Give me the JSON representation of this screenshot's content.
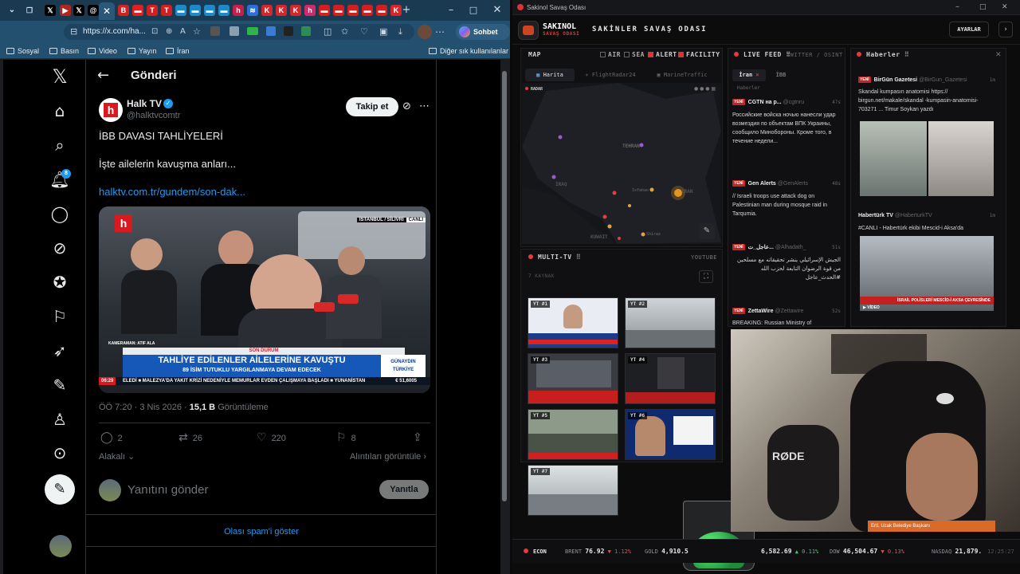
{
  "browser": {
    "url": "https://x.com/ha...",
    "copilot_label": "Sohbet et",
    "bookmarks": [
      "Sosyal",
      "Basın",
      "Video",
      "Yayın",
      "İran"
    ],
    "other_bookmarks": "Diğer sık kullanılanlar"
  },
  "x": {
    "header_title": "Gönderi",
    "author_name": "Halk TV",
    "author_handle": "@halktvcomtr",
    "follow_label": "Takip et",
    "post_line1": "İBB DAVASI TAHLİYELERİ",
    "post_line2": "İşte ailelerin kavuşma anları...",
    "post_link": "halktv.com.tr/gundem/son-dak...",
    "notif_count": "8",
    "video": {
      "location_tag": "İSTANBUL / SİLİVRİ",
      "live_tag": "CANLI",
      "cameraman": "KAMERAMAN: ATIF ALA",
      "son_durum": "SON DURUM",
      "headline": "TAHLİYE EDİLENLER AİLELERİNE KAVUŞTU",
      "subheadline": "89 İSİM TUTUKLU YARGILANMAYA DEVAM EDECEK",
      "ticker": "ELEDİ  ■ MALEZYA'DA YAKIT KRİZİ NEDENİYLE MEMURLAR EVDEN ÇALIŞMAYA BAŞLADI  ■ YUNANİSTAN",
      "time": "06:29",
      "program": "GÜNAYDIN TÜRKİYE",
      "euro": "€ 51,6005"
    },
    "meta_time": "ÖÖ 7:20 · 3 Nis 2026 · ",
    "views_count": "15,1 B",
    "views_label": " Görüntüleme",
    "replies": "2",
    "reposts": "26",
    "likes": "220",
    "bookmarks": "8",
    "relevant": "Alakalı",
    "quotes": "Alıntıları görüntüle",
    "reply_placeholder": "Yanıtını gönder",
    "reply_button": "Yanıtla",
    "spam_link": "Olası spam'i göster"
  },
  "dash": {
    "window_title": "Sakinol Savaş Odası",
    "logo_top": "SAKINOL",
    "logo_bottom": "SAVAŞ ODASI",
    "header_title": "SAKİNLER SAVAŞ ODASI",
    "settings": "AYARLAR",
    "map": {
      "label": "MAP",
      "toggles": [
        "AIR",
        "SEA",
        "ALERT",
        "FACILITY"
      ],
      "tabs": [
        "Harita",
        "FlightRadar24",
        "MarineTraffic"
      ],
      "radar": "RADAR",
      "places": [
        "TEHRAN",
        "IRAQ",
        "Isfahan",
        "IRAN",
        "KUWAIT",
        "Shiraz"
      ]
    },
    "feed": {
      "label": "LIVE FEED",
      "sub": "TWITTER / OSINT",
      "tabs": [
        "İran",
        "İBB"
      ],
      "haberler_tab": "Haberler",
      "items": [
        {
          "src": "CGTN на р...",
          "handle": "@cgtnru",
          "age": "47s",
          "text": "Российские войска ночью нанесли удар возмездия по объектам ВПК Украины, сообщило Минобороны. Кроме того, в течение недели..."
        },
        {
          "src": "Gen Alerts",
          "handle": "@GenAlerts",
          "age": "48s",
          "text": "// Israeli troops use attack dog on Palestinian man during mosque raid in Tarqumia."
        },
        {
          "src": "عاجل_ت...",
          "handle": "@Alhadath_",
          "age": "51s",
          "text": "الجيش الإسرائيلي ينشر تحقيقاته مع مسلحين من قوة الرضوان التابعة لحزب الله #الحدث_عاجل"
        },
        {
          "src": "ZettaWire",
          "handle": "@Zettawire",
          "age": "52s",
          "text": "BREAKING: Russian Ministry of"
        }
      ]
    },
    "news": {
      "label": "Haberler",
      "items": [
        {
          "src": "BirGün Gazetesi",
          "handle": "@BirGun_Gazetesi",
          "age": "1m",
          "text": "Skandal kumpasın anatomisi https:// birgun.net/makale/skandal -kumpasin-anatomisi- 703271 ... Timur Soykan yazdı"
        },
        {
          "src": "Habertürk TV",
          "handle": "@HaberturkTV",
          "age": "1m",
          "text": "#CANLI - Habertürk ekibi Mescid-i Aksa'da",
          "caption": "İSRAİL POLİSLERİ MESCİD-İ AKSA ÇEVRESİNDE",
          "video": "VİDEO"
        }
      ]
    },
    "multitv": {
      "label": "MULTI-TV",
      "sub": "YOUTUBE",
      "sources": "7 KAYNAK",
      "tiles": [
        "YT #1",
        "YT #2",
        "YT #3",
        "YT #4",
        "YT #5",
        "YT #6",
        "YT #7"
      ]
    },
    "ticker": [
      {
        "name": "ECON",
        "value": "",
        "chg": ""
      },
      {
        "name": "BRENT",
        "value": "76.92",
        "chg": "▼ 1.12%"
      },
      {
        "name": "GOLD",
        "value": "4,910.5",
        "chg": ""
      },
      {
        "name": "",
        "value": "6,582.69",
        "chg": "▲ 0.11%"
      },
      {
        "name": "DOW",
        "value": "46,504.67",
        "chg": "▼ 0.13%"
      },
      {
        "name": "NASDAQ",
        "value": "21,879.",
        "chg": ""
      }
    ],
    "clock": "12:25:27",
    "webcam_mic": "RØDE",
    "webcam_footer": "Ertl, Uzak Belediye Başkanı"
  }
}
